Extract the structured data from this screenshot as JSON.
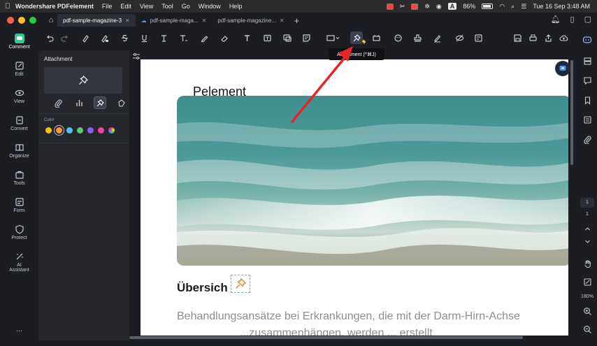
{
  "menubar": {
    "app_name": "Wondershare PDFelement",
    "items": [
      "File",
      "Edit",
      "View",
      "Tool",
      "Go",
      "Window",
      "Help"
    ],
    "battery": "86%",
    "datetime": "Tue 16 Sep  3:48 AM",
    "input_badge": "A"
  },
  "tabs": [
    {
      "label": "pdf-sample-magazine-3",
      "active": true
    },
    {
      "label": "pdf-sample-maga...",
      "active": false
    },
    {
      "label": "pdf-sample-magazine...",
      "active": false
    }
  ],
  "leftnav": [
    {
      "label": "Comment",
      "icon": "comment-icon",
      "active": true
    },
    {
      "label": "Edit",
      "icon": "edit-icon"
    },
    {
      "label": "View",
      "icon": "eye-icon"
    },
    {
      "label": "Convert",
      "icon": "convert-icon"
    },
    {
      "label": "Organize",
      "icon": "organize-icon"
    },
    {
      "label": "Tools",
      "icon": "toolbox-icon"
    },
    {
      "label": "Form",
      "icon": "form-icon"
    },
    {
      "label": "Protect",
      "icon": "shield-icon"
    },
    {
      "label": "AI",
      "label2": "Assistant",
      "icon": "ai-assistant-icon"
    },
    {
      "label": "...",
      "icon": "more-icon"
    }
  ],
  "panel": {
    "title": "Attachment",
    "color_label": "Color",
    "colors": [
      "#f5c518",
      "#f39c3d",
      "#4fc3f7",
      "#57c96f",
      "#8b5cf6",
      "#ec4899",
      "rainbow"
    ],
    "selected_color_index": 1
  },
  "tooltip": "Attachment (^⌘J)",
  "document": {
    "title": "Pelement",
    "heading": "Übersich",
    "body": "Behandlungsansätze bei Erkrankungen, die mit der Darm-Hirn-Achse",
    "body_line2": "...zusammenhängen, werden ... erstellt"
  },
  "rightbar": {
    "page_current": "1",
    "page_total": "1",
    "zoom": "180%"
  }
}
